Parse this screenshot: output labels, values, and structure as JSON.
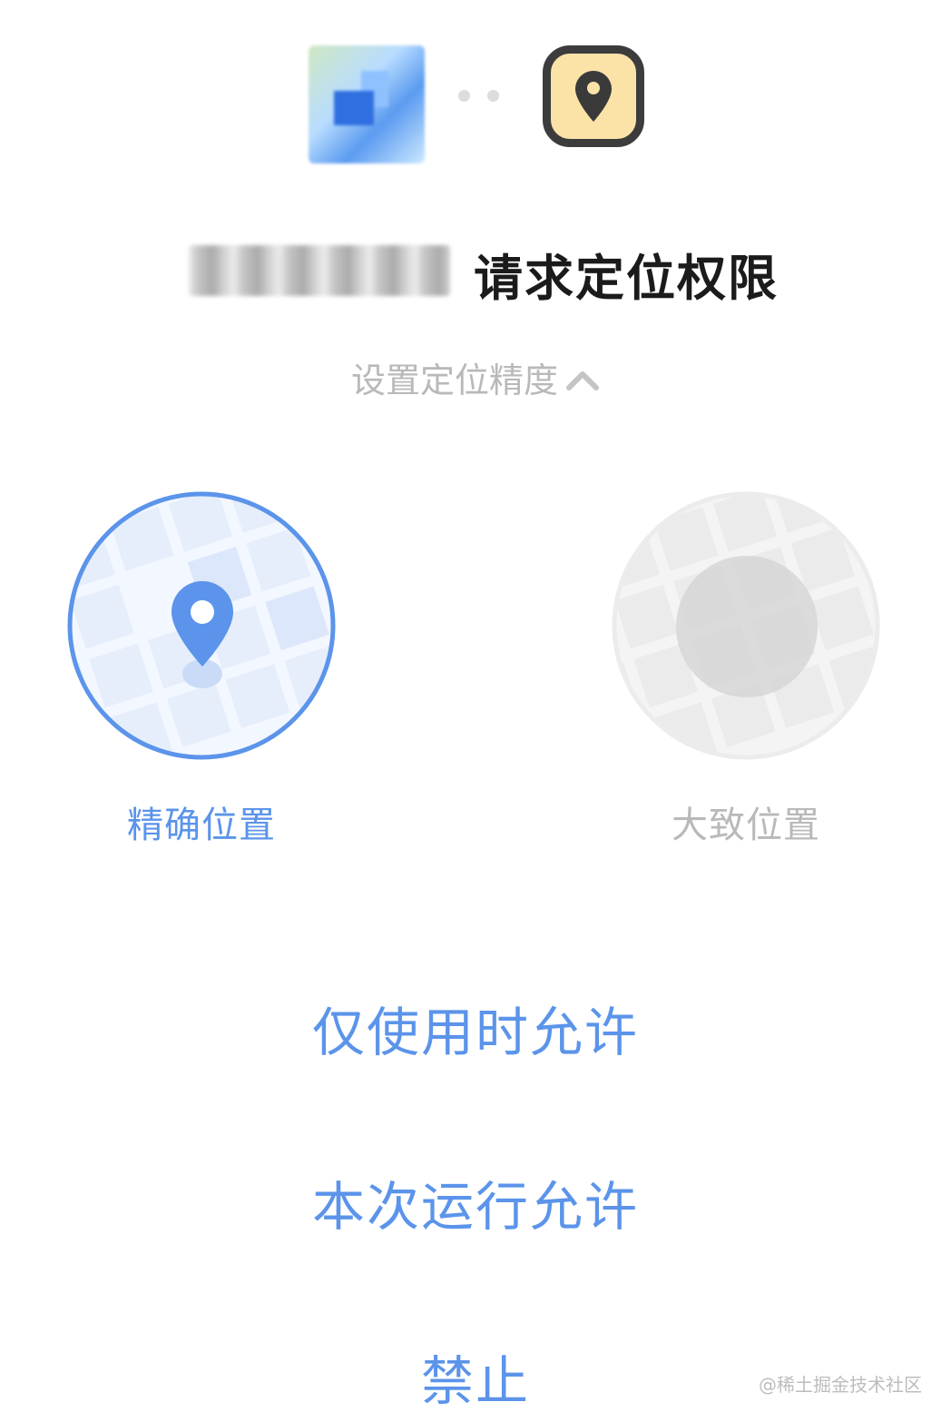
{
  "header": {
    "app_icon": "blurred-app-icon",
    "connector": "dots",
    "permission_icon": "location-pin-icon",
    "permission_icon_bg": "#fbe3a8",
    "permission_icon_border": "#3c3c3c"
  },
  "title": {
    "text": "请求定位权限"
  },
  "precision": {
    "label": "设置定位精度",
    "icon": "chevron-up-icon"
  },
  "options": [
    {
      "label": "精确位置",
      "selected": true,
      "icon": "location-pin-icon"
    },
    {
      "label": "大致位置",
      "selected": false,
      "icon": "approximate-area-icon"
    }
  ],
  "actions": {
    "while_using": "仅使用时允许",
    "this_time": "本次运行允许",
    "deny": "禁止"
  },
  "colors": {
    "accent": "#5b94ea",
    "muted": "#b9b9b9",
    "title": "#1b1b1b"
  },
  "watermark": "@稀土掘金技术社区"
}
